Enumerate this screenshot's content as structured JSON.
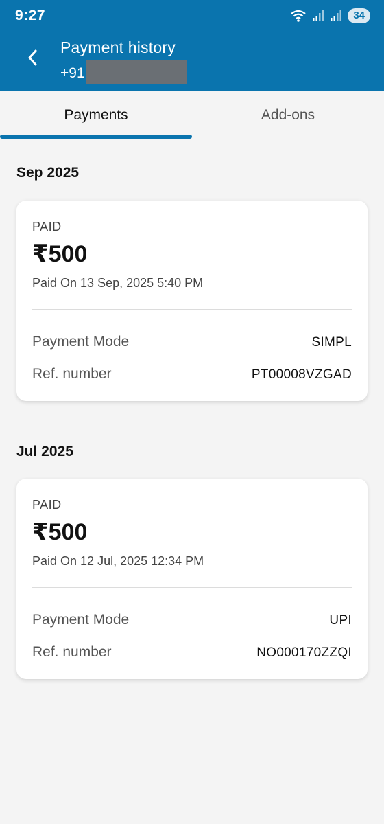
{
  "status_bar": {
    "time": "9:27",
    "battery": "34",
    "icons": [
      "wifi-icon",
      "signal-icon",
      "signal-icon",
      "battery-icon"
    ]
  },
  "app_bar": {
    "title": "Payment history",
    "phone_prefix": "+91",
    "colors": {
      "background": "#0a74ae",
      "text": "#ffffff"
    }
  },
  "tabs": [
    {
      "label": "Payments",
      "active": true
    },
    {
      "label": "Add-ons",
      "active": false
    }
  ],
  "groups": [
    {
      "month": "Sep 2025",
      "payments": [
        {
          "status": "PAID",
          "amount": "₹500",
          "paid_on": "Paid On 13 Sep, 2025 5:40 PM",
          "mode_label": "Payment Mode",
          "mode_value": "SIMPL",
          "ref_label": "Ref. number",
          "ref_value": "PT00008VZGAD"
        }
      ]
    },
    {
      "month": "Jul 2025",
      "payments": [
        {
          "status": "PAID",
          "amount": "₹500",
          "paid_on": "Paid On 12 Jul, 2025 12:34 PM",
          "mode_label": "Payment Mode",
          "mode_value": "UPI",
          "ref_label": "Ref. number",
          "ref_value": "NO000170ZZQI"
        }
      ]
    }
  ]
}
